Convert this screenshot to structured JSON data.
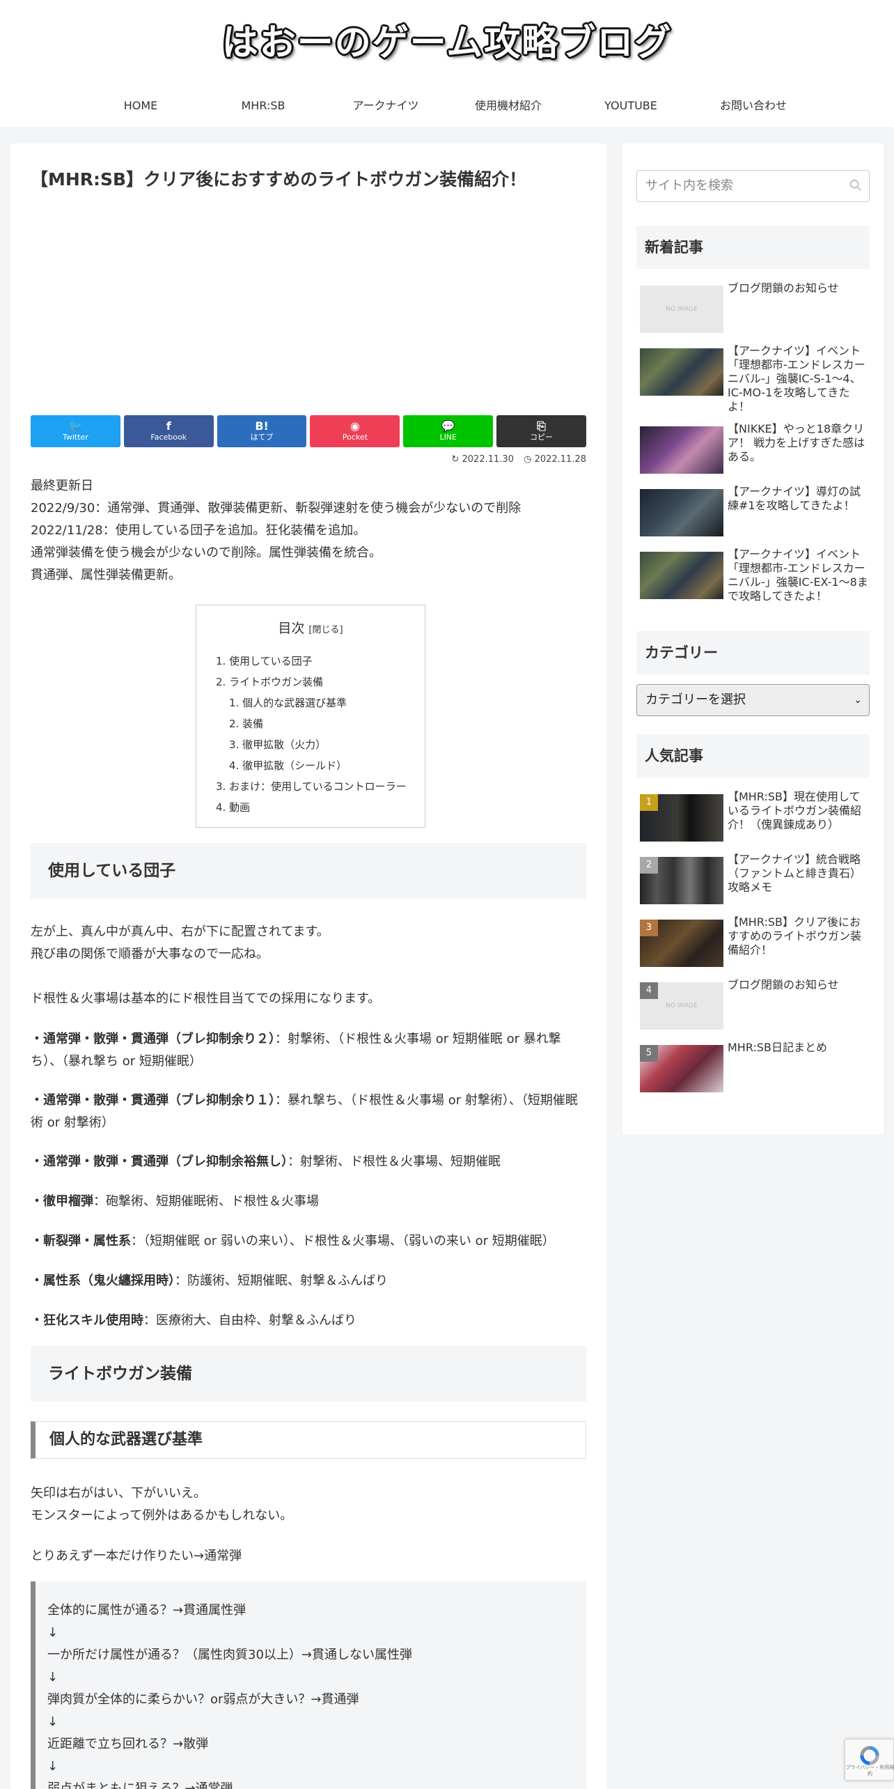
{
  "site": {
    "title": "はおーのゲーム攻略ブログ",
    "nav": [
      "HOME",
      "MHR:SB",
      "アークナイツ",
      "使用機材紹介",
      "YOUTUBE",
      "お問い合わせ"
    ]
  },
  "article": {
    "title": "【MHR:SB】クリア後におすすめのライトボウガン装備紹介！",
    "share": [
      {
        "glyph": "🐦",
        "label": "Twitter",
        "color": "#1da1f2"
      },
      {
        "glyph": "f",
        "label": "Facebook",
        "color": "#3b5998"
      },
      {
        "glyph": "B!",
        "label": "はてブ",
        "color": "#2c6ebd"
      },
      {
        "glyph": "◉",
        "label": "Pocket",
        "color": "#ef3f56"
      },
      {
        "glyph": "💬",
        "label": "LINE",
        "color": "#00c300"
      },
      {
        "glyph": "⎘",
        "label": "コピー",
        "color": "#333333"
      }
    ],
    "updated": "2022.11.30",
    "posted": "2022.11.28",
    "intro": [
      "最終更新日",
      "2022/9/30：通常弾、貫通弾、散弾装備更新、斬裂弾速射を使う機会が少ないので削除",
      "2022/11/28：使用している団子を追加。狂化装備を追加。",
      "通常弾装備を使う機会が少ないので削除。属性弾装備を統合。",
      "貫通弾、属性弾装備更新。"
    ],
    "toc": {
      "title": "目次",
      "toggle": "[閉じる]",
      "items": [
        {
          "label": "1. 使用している団子",
          "sub": false
        },
        {
          "label": "2. ライトボウガン装備",
          "sub": false
        },
        {
          "label": "1. 個人的な武器選び基準",
          "sub": true
        },
        {
          "label": "2. 装備",
          "sub": true
        },
        {
          "label": "3. 徹甲拡散（火力）",
          "sub": true
        },
        {
          "label": "4. 徹甲拡散（シールド）",
          "sub": true
        },
        {
          "label": "3. おまけ：使用しているコントローラー",
          "sub": false
        },
        {
          "label": "4. 動画",
          "sub": false
        }
      ]
    },
    "h2_dango": "使用している団子",
    "dango_p1": [
      "左が上、真ん中が真ん中、右が下に配置されてます。",
      "飛び串の関係で順番が大事なので一応ね。"
    ],
    "dango_p2": "ド根性＆火事場は基本的にド根性目当てでの採用になります。",
    "dango_lines": [
      {
        "bold": "・通常弾・散弾・貫通弾（ブレ抑制余り２）",
        "text": "：射撃術、（ド根性＆火事場 or 短期催眠 or 暴れ撃ち）、（暴れ撃ち or 短期催眠）"
      },
      {
        "bold": "・通常弾・散弾・貫通弾（ブレ抑制余り１）",
        "text": "：暴れ撃ち、（ド根性＆火事場 or 射撃術）、（短期催眠術 or 射撃術）"
      },
      {
        "bold": "・通常弾・散弾・貫通弾（ブレ抑制余裕無し）",
        "text": "：射撃術、ド根性＆火事場、短期催眠"
      },
      {
        "bold": "・徹甲榴弾",
        "text": "：砲撃術、短期催眠術、ド根性＆火事場"
      },
      {
        "bold": "・斬裂弾・属性系",
        "text": "：（短期催眠 or 弱いの来い）、ド根性＆火事場、（弱いの来い or 短期催眠）"
      },
      {
        "bold": "・属性系（鬼火纏採用時）",
        "text": "：防護術、短期催眠、射撃＆ふんばり"
      },
      {
        "bold": "・狂化スキル使用時",
        "text": "：医療術大、自由枠、射撃＆ふんばり"
      }
    ],
    "h2_equip": "ライトボウガン装備",
    "h3_criteria": "個人的な武器選び基準",
    "criteria_p1": [
      "矢印は右がはい、下がいいえ。",
      "モンスターによって例外はあるかもしれない。"
    ],
    "criteria_p2": "とりあえず一本だけ作りたい→通常弾",
    "flow": [
      "全体的に属性が通る？→貫通属性弾",
      "↓",
      "一か所だけ属性が通る？（属性肉質30以上）→貫通しない属性弾",
      "↓",
      "弾肉質が全体的に柔らかい？or弱点が大きい？→貫通弾",
      "↓",
      "近距離で立ち回れる？→散弾",
      "↓",
      "弱点がまともに狙える？→通常弾"
    ]
  },
  "sidebar": {
    "search_placeholder": "サイト内を検索",
    "new_title": "新着記事",
    "new_posts": [
      {
        "title": "ブログ閉鎖のお知らせ",
        "thumb": "noimage",
        "noimage_label": "NO IMAGE"
      },
      {
        "title": "【アークナイツ】イベント「理想都市-エンドレスカーニバル-」強襲IC-S-1～4、IC-MO-1を攻略してきたよ！",
        "thumb": "map"
      },
      {
        "title": "【NIKKE】やっと18章クリア！ 戦力を上げすぎた感はある。",
        "thumb": "purple"
      },
      {
        "title": "【アークナイツ】導灯の試練#1を攻略してきたよ！",
        "thumb": "dark"
      },
      {
        "title": "【アークナイツ】イベント「理想都市-エンドレスカーニバル-」強襲IC-EX-1～8まで攻略してきたよ！",
        "thumb": "map"
      }
    ],
    "category_title": "カテゴリー",
    "category_select": "カテゴリーを選択",
    "popular_title": "人気記事",
    "popular_posts": [
      {
        "rank": "1",
        "title": "【MHR:SB】現在使用しているライトボウガン装備紹介！（傀異錬成あり）",
        "thumb": "mhr",
        "rank_color": "#c6a11e"
      },
      {
        "rank": "2",
        "title": "【アークナイツ】統合戦略（ファントムと緋き貴石）攻略メモ",
        "thumb": "cards",
        "rank_color": "#a8a8a8"
      },
      {
        "rank": "3",
        "title": "【MHR:SB】クリア後におすすめのライトボウガン装備紹介！",
        "thumb": "mhr2",
        "rank_color": "#b07540"
      },
      {
        "rank": "4",
        "title": "ブログ閉鎖のお知らせ",
        "thumb": "noimage",
        "rank_color": "#777777",
        "noimage_label": "NO IMAGE"
      },
      {
        "rank": "5",
        "title": "MHR:SB日記まとめ",
        "thumb": "monster",
        "rank_color": "#777777"
      }
    ]
  },
  "recaptcha": {
    "text": "プライバシー・利用規約"
  }
}
